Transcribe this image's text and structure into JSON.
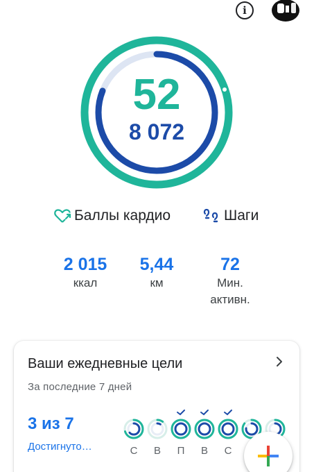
{
  "header": {
    "info_icon": "info-icon",
    "avatar_icon": "avatar-icon"
  },
  "rings": {
    "heart_points_value": "52",
    "steps_value": "8 072",
    "outer_ring_color": "#1fb59a",
    "inner_ring_color": "#1c4ba8",
    "track_color": "#dde5f3",
    "heart_points_progress": 0.98,
    "steps_progress": 0.81
  },
  "legend": {
    "cardio_label": "Баллы кардио",
    "steps_label": "Шаги"
  },
  "stats": [
    {
      "value": "2 015",
      "label": "ккал"
    },
    {
      "value": "5,44",
      "label": "км"
    },
    {
      "value": "72",
      "label_line1": "Мин.",
      "label_line2": "активн."
    }
  ],
  "goals_card": {
    "title": "Ваши ежедневные цели",
    "subtitle": "За последние 7 дней",
    "count": "3 из 7",
    "status": "Достигнуто…",
    "days": [
      {
        "letter": "С",
        "achieved": false,
        "progress": 0.7
      },
      {
        "letter": "В",
        "achieved": false,
        "progress": 0.1
      },
      {
        "letter": "П",
        "achieved": true,
        "progress": 1
      },
      {
        "letter": "В",
        "achieved": true,
        "progress": 1
      },
      {
        "letter": "С",
        "achieved": true,
        "progress": 1
      },
      {
        "letter": "",
        "achieved": false,
        "progress": 0.85
      },
      {
        "letter": "",
        "achieved": false,
        "progress": 0.6
      }
    ]
  },
  "fab": {
    "icon": "plus-icon"
  }
}
